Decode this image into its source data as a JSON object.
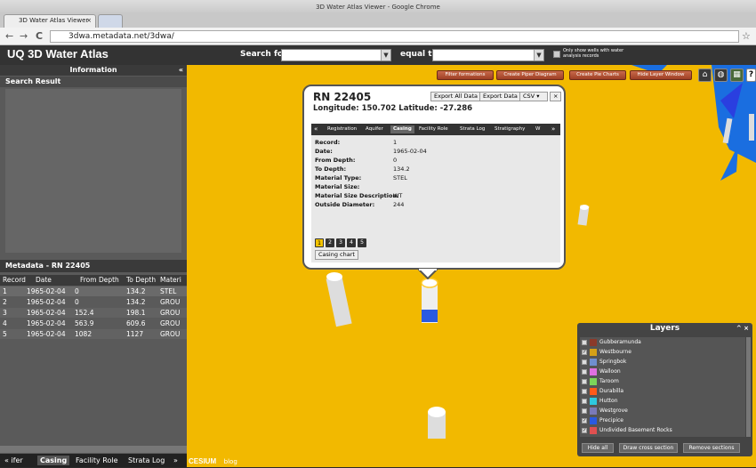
{
  "browser": {
    "window_title": "3D Water Atlas Viewer - Google Chrome",
    "tab_title": "3D Water Atlas Viewer",
    "tab_close": "×",
    "url": "3dwa.metadata.net/3dwa/",
    "back": "←",
    "forward": "→",
    "reload": "C",
    "star": "☆"
  },
  "header": {
    "title": "UQ 3D Water Atlas",
    "search_for_label": "Search for",
    "equal_to_label": "equal to",
    "only_show_label": "Only show wells with water analysis records"
  },
  "left_panel": {
    "information_title": "Information",
    "collapse": "«",
    "search_result_title": "Search Result",
    "metadata_title": "Metadata - RN 22405",
    "columns": [
      "Record",
      "Date",
      "From Depth",
      "To Depth",
      "Materi"
    ],
    "rows": [
      [
        "1",
        "1965-02-04",
        "0",
        "134.2",
        "STEL"
      ],
      [
        "2",
        "1965-02-04",
        "0",
        "134.2",
        "GROU"
      ],
      [
        "3",
        "1965-02-04",
        "152.4",
        "198.1",
        "GROU"
      ],
      [
        "4",
        "1965-02-04",
        "563.9",
        "609.6",
        "GROU"
      ],
      [
        "5",
        "1965-02-04",
        "1082",
        "1127",
        "GROU"
      ]
    ],
    "bottom_tabs": [
      "« ifer",
      "Casing",
      "Facility Role",
      "Strata Log",
      "» "
    ]
  },
  "toolbar": {
    "filter": "Filter formations",
    "piper": "Create Piper Diagram",
    "pie": "Create Pie Charts",
    "hide_layer": "Hide Layer Window",
    "help": "?"
  },
  "popup": {
    "rn": "RN 22405",
    "lonlat": "Longitude: 150.702 Latitude: -27.286",
    "export_all": "Export All Data",
    "export": "Export Data",
    "format": "CSV",
    "close": "×",
    "tabs": [
      "Registration",
      "Aquifer",
      "Casing",
      "Facility Role",
      "Strata Log",
      "Stratigraphy",
      "W"
    ],
    "tab_prev": "«",
    "tab_next": "»",
    "active_tab": "Casing",
    "fields": [
      {
        "label": "Record:",
        "value": "1"
      },
      {
        "label": "Date:",
        "value": "1965-02-04"
      },
      {
        "label": "From Depth:",
        "value": "0"
      },
      {
        "label": "To Depth:",
        "value": "134.2"
      },
      {
        "label": "Material Type:",
        "value": "STEL"
      },
      {
        "label": "Material Size:",
        "value": ""
      },
      {
        "label": "Material Size Description:",
        "value": "WT"
      },
      {
        "label": "Outside Diameter:",
        "value": "244"
      }
    ],
    "pages": [
      "1",
      "2",
      "3",
      "4",
      "5"
    ],
    "chart_button": "Casing chart"
  },
  "layers": {
    "title": "Layers",
    "controls": "^ ×",
    "items": [
      {
        "name": "Gubberamunda",
        "checked": false,
        "color": "#8b3a2a"
      },
      {
        "name": "Westbourne",
        "checked": true,
        "color": "#d4a017"
      },
      {
        "name": "Springbok",
        "checked": false,
        "color": "#6f8fcf"
      },
      {
        "name": "Walloon",
        "checked": false,
        "color": "#e070e0"
      },
      {
        "name": "Taroom",
        "checked": false,
        "color": "#7cd45a"
      },
      {
        "name": "Durabilla",
        "checked": false,
        "color": "#ff5a1a"
      },
      {
        "name": "Hutton",
        "checked": false,
        "color": "#2ec8e0"
      },
      {
        "name": "Westgrove",
        "checked": false,
        "color": "#7a7ab8"
      },
      {
        "name": "Precipice",
        "checked": true,
        "color": "#2a5ae0"
      },
      {
        "name": "Undivided Basement Rocks",
        "checked": true,
        "color": "#e05050"
      }
    ],
    "hide_all": "Hide all",
    "draw_cross": "Draw cross section",
    "remove_sections": "Remove sections"
  },
  "footer": {
    "cesium": "CESIUM",
    "blog": "blog"
  },
  "colors": {
    "map_yellow": "#f2b900",
    "map_blue": "#1a6ee0",
    "panel_bg": "#5a5a5a"
  }
}
